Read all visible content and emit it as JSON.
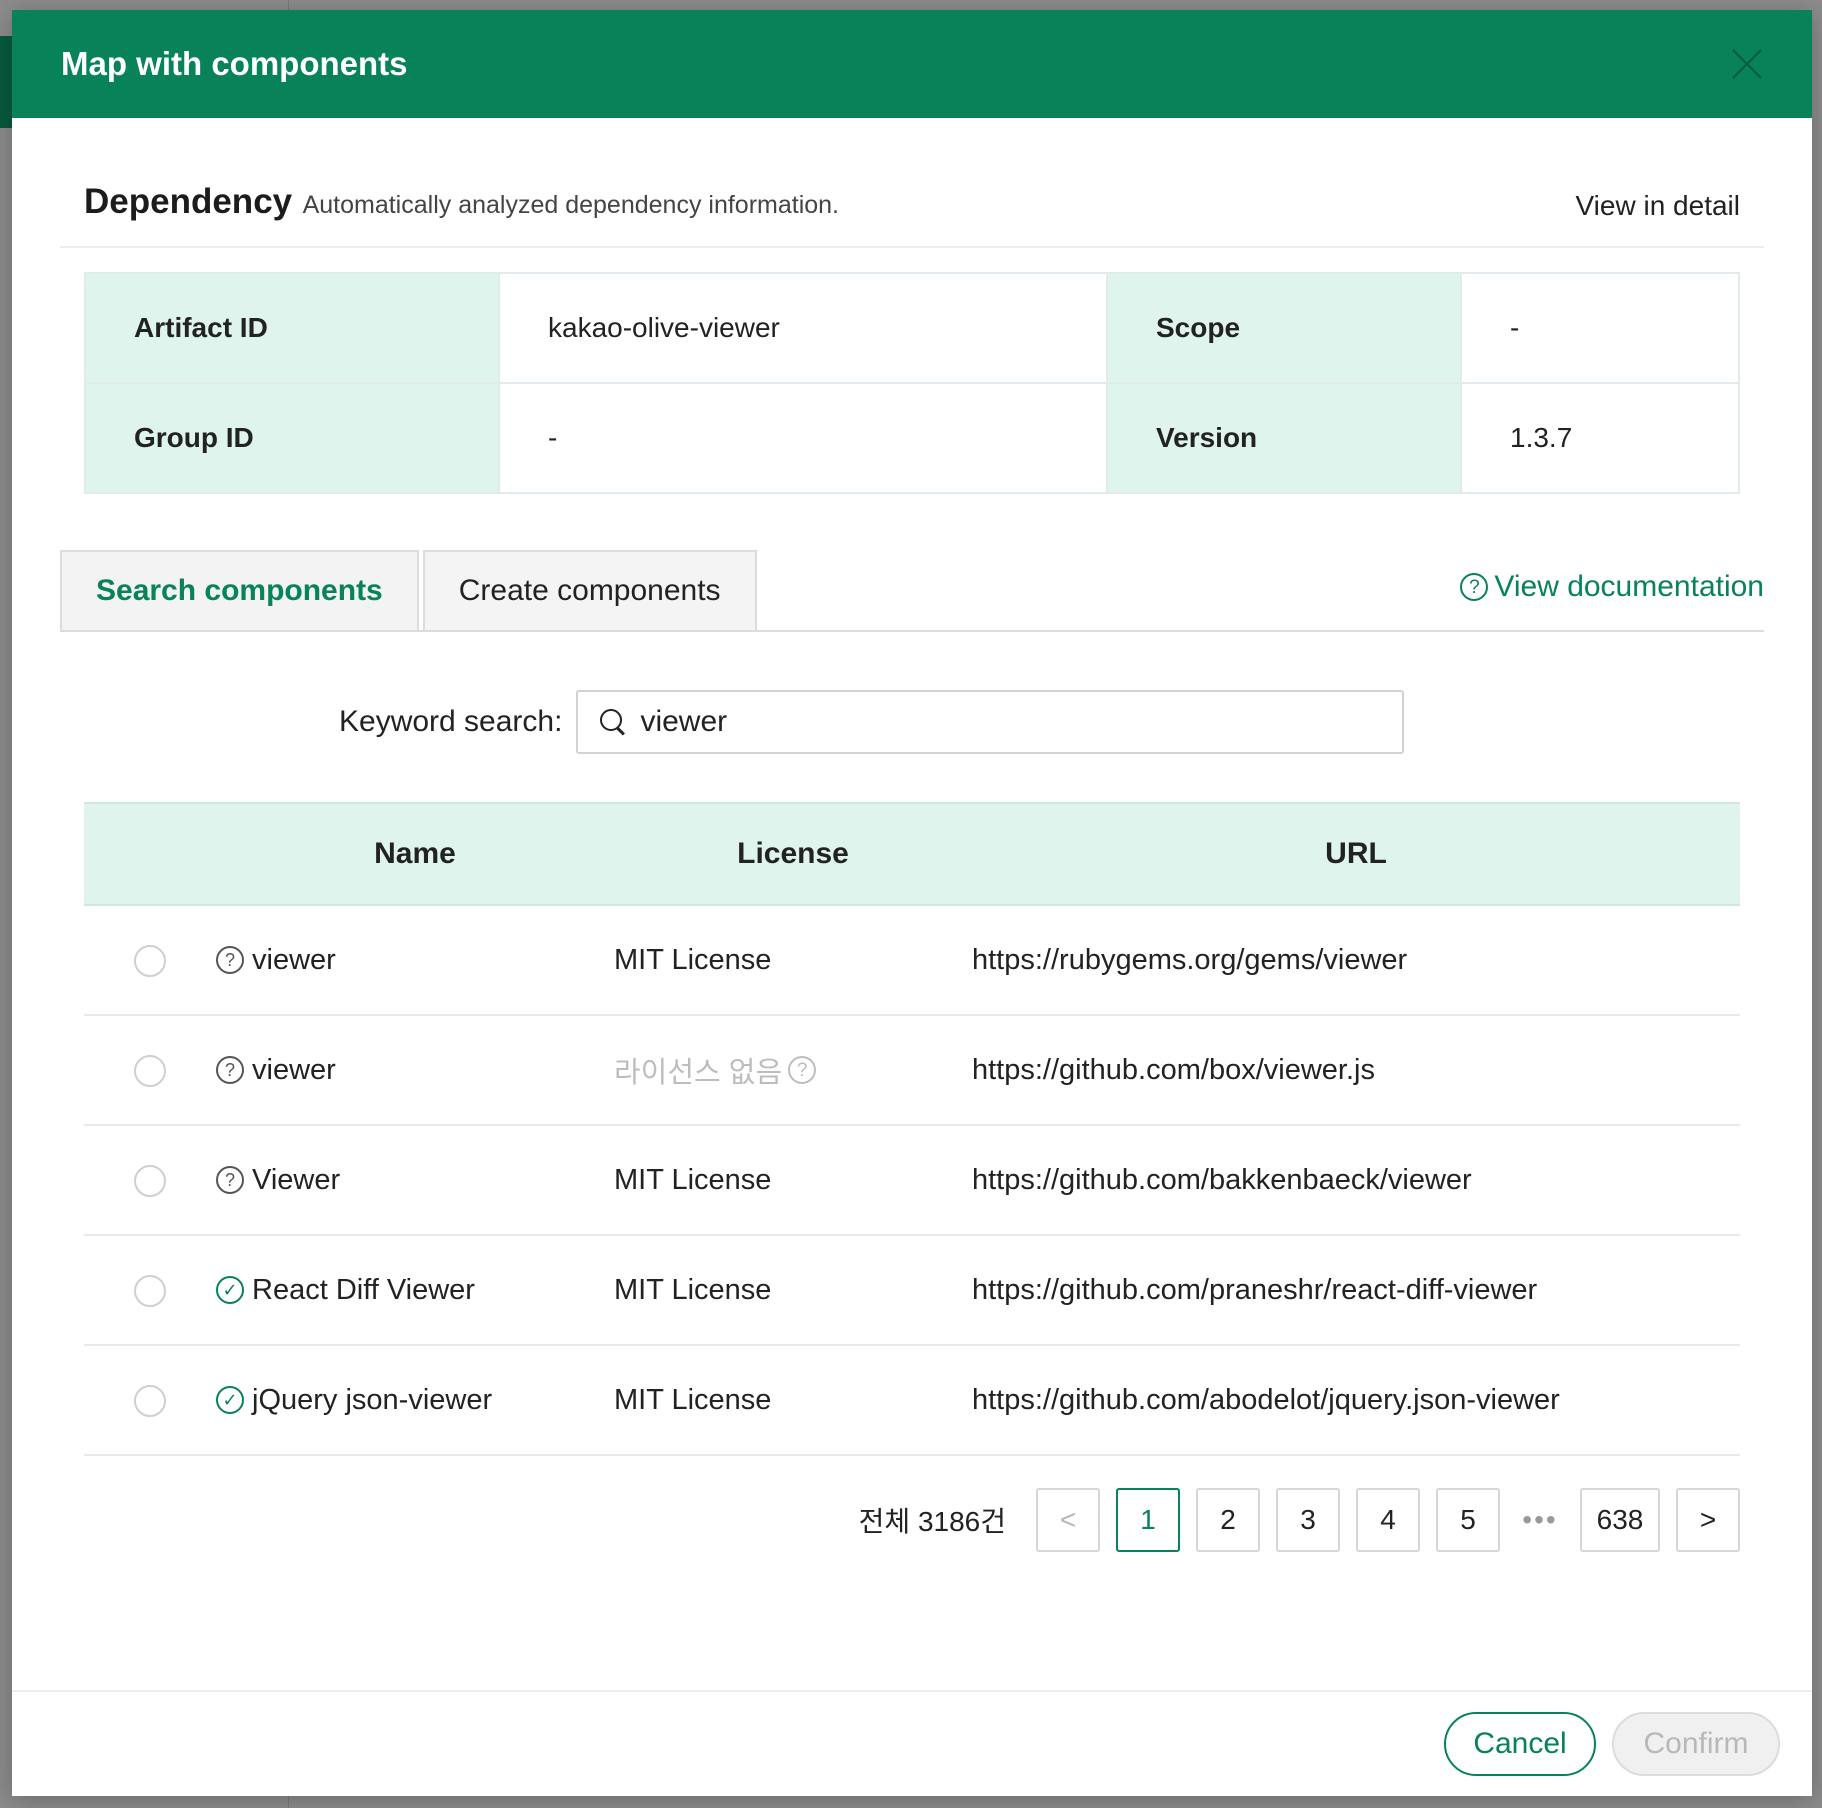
{
  "modal": {
    "title": "Map with components"
  },
  "dependency": {
    "title": "Dependency",
    "subtitle": "Automatically analyzed dependency information.",
    "view_detail": "View in detail",
    "fields": {
      "artifact_id_label": "Artifact ID",
      "artifact_id_value": "kakao-olive-viewer",
      "scope_label": "Scope",
      "scope_value": "-",
      "group_id_label": "Group ID",
      "group_id_value": "-",
      "version_label": "Version",
      "version_value": "1.3.7"
    }
  },
  "tabs": [
    {
      "label": "Search components",
      "active": true
    },
    {
      "label": "Create components",
      "active": false
    }
  ],
  "view_documentation": "View documentation",
  "search": {
    "label": "Keyword search",
    "separator": ":",
    "value": "viewer",
    "icon": "search-icon"
  },
  "results": {
    "columns": [
      "Name",
      "License",
      "URL"
    ],
    "rows": [
      {
        "name": "viewer",
        "status": "unverified",
        "license": "MIT License",
        "url": "https://rubygems.org/gems/viewer"
      },
      {
        "name": "viewer",
        "status": "unverified",
        "license": "라이선스 없음",
        "license_muted": true,
        "url": "https://github.com/box/viewer.js"
      },
      {
        "name": "Viewer",
        "status": "unverified",
        "license": "MIT License",
        "url": "https://github.com/bakkenbaeck/viewer"
      },
      {
        "name": "React Diff Viewer",
        "status": "verified",
        "license": "MIT License",
        "url": "https://github.com/praneshr/react-diff-viewer"
      },
      {
        "name": "jQuery json-viewer",
        "status": "verified",
        "license": "MIT License",
        "url": "https://github.com/abodelot/jquery.json-viewer"
      }
    ]
  },
  "pagination": {
    "total": "전체 3186건",
    "prev": "<",
    "next": ">",
    "pages": [
      "1",
      "2",
      "3",
      "4",
      "5"
    ],
    "current": "1",
    "ellipsis": "•••",
    "last": "638"
  },
  "footer": {
    "cancel": "Cancel",
    "confirm": "Confirm"
  },
  "colors": {
    "brand": "#078259",
    "header_cell_bg": "#dff4ec"
  }
}
